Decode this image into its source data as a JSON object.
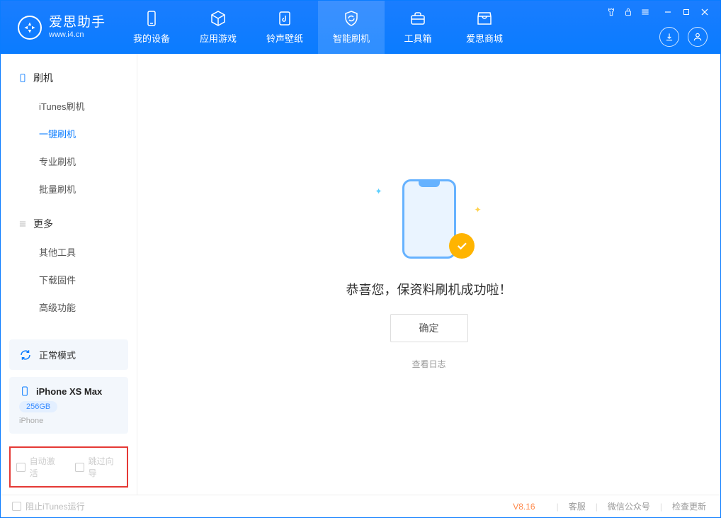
{
  "app": {
    "title": "爱思助手",
    "url": "www.i4.cn"
  },
  "header": {
    "tabs": [
      {
        "label": "我的设备"
      },
      {
        "label": "应用游戏"
      },
      {
        "label": "铃声壁纸"
      },
      {
        "label": "智能刷机"
      },
      {
        "label": "工具箱"
      },
      {
        "label": "爱思商城"
      }
    ]
  },
  "sidebar": {
    "sec_flash": "刷机",
    "sec_more": "更多",
    "flash_items": [
      {
        "label": "iTunes刷机"
      },
      {
        "label": "一键刷机"
      },
      {
        "label": "专业刷机"
      },
      {
        "label": "批量刷机"
      }
    ],
    "more_items": [
      {
        "label": "其他工具"
      },
      {
        "label": "下载固件"
      },
      {
        "label": "高级功能"
      }
    ],
    "mode_label": "正常模式",
    "device": {
      "name": "iPhone XS Max",
      "storage": "256GB",
      "type": "iPhone"
    },
    "chk_auto": "自动激活",
    "chk_skip": "跳过向导"
  },
  "main": {
    "success_msg": "恭喜您，保资料刷机成功啦！",
    "ok": "确定",
    "log": "查看日志"
  },
  "footer": {
    "block_itunes": "阻止iTunes运行",
    "version": "V8.16",
    "links": {
      "kefu": "客服",
      "wechat": "微信公众号",
      "update": "检查更新"
    }
  }
}
